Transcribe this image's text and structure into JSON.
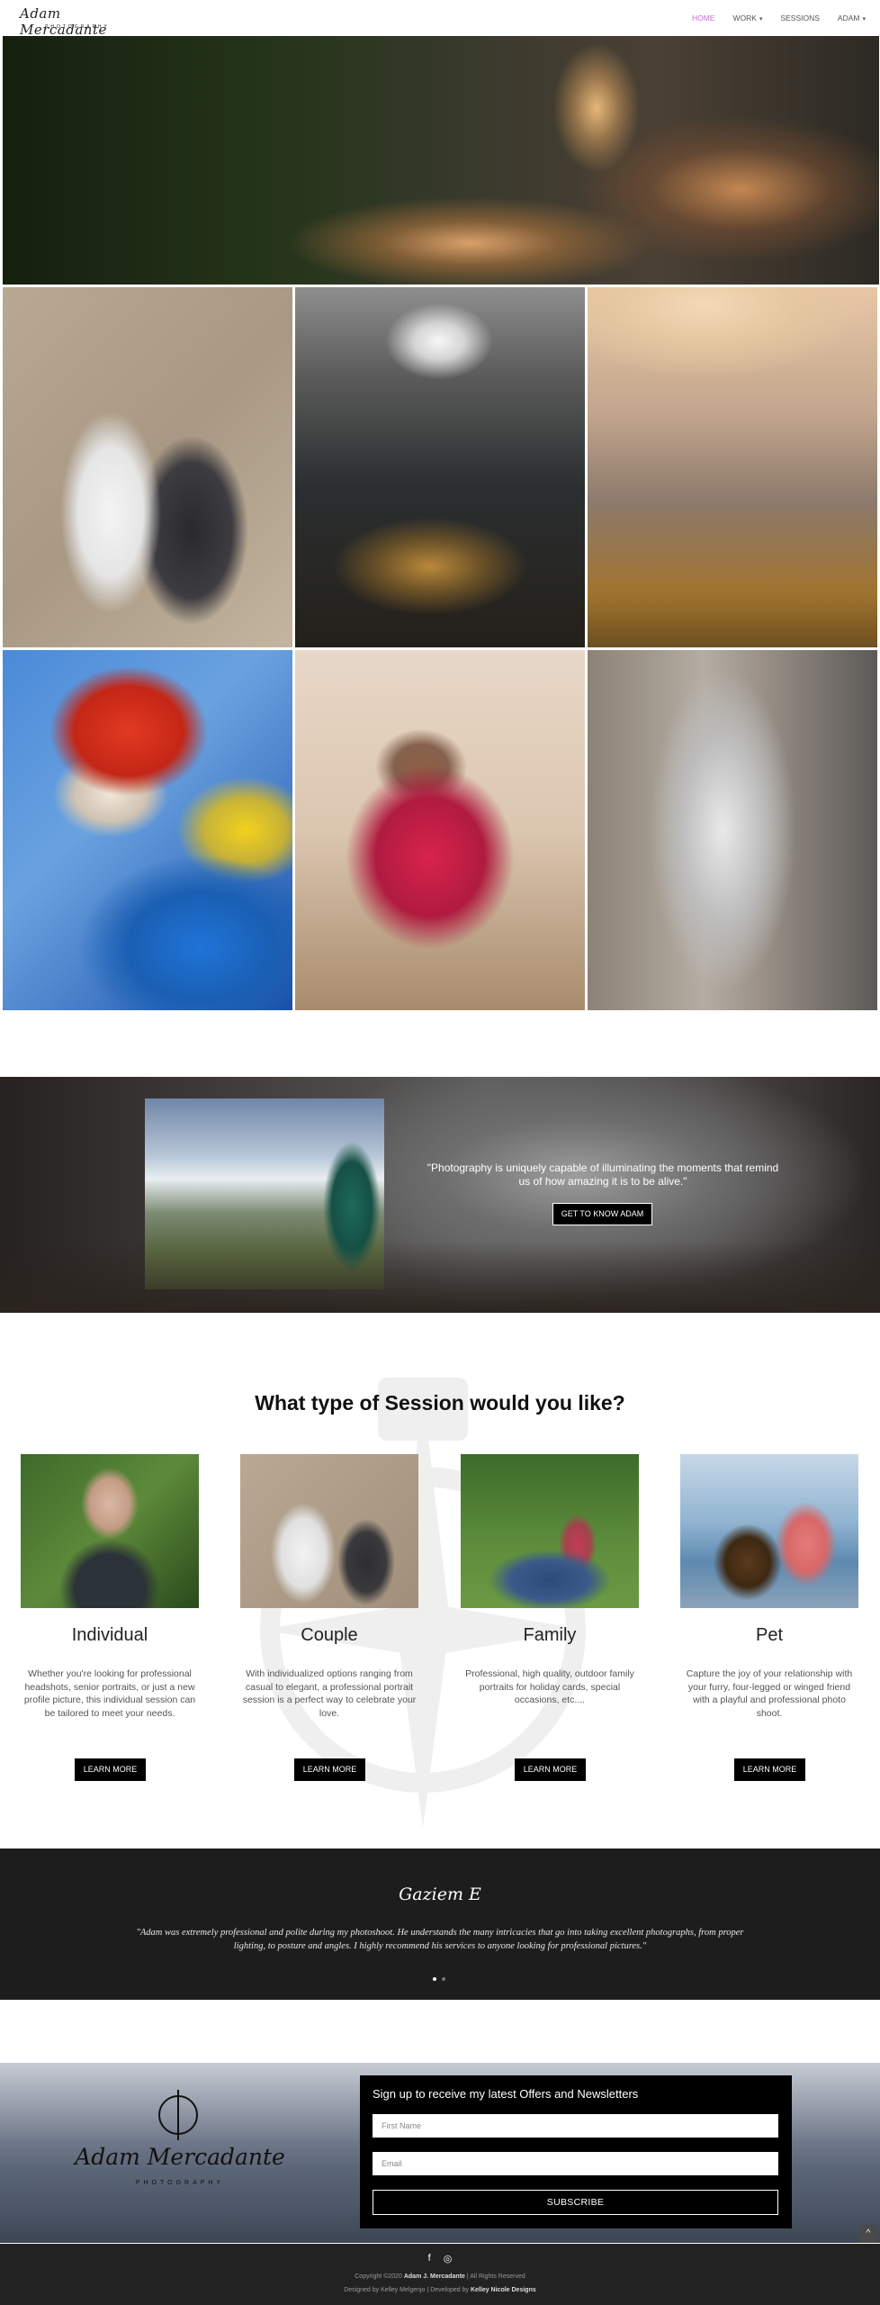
{
  "header": {
    "logo_script": "Adam Mercadante",
    "logo_sub": "PHOTOGRAPHY",
    "nav": [
      {
        "label": "HOME",
        "active": true,
        "has_menu": false
      },
      {
        "label": "WORK",
        "active": false,
        "has_menu": true
      },
      {
        "label": "SESSIONS",
        "active": false,
        "has_menu": false
      },
      {
        "label": "ADAM",
        "active": false,
        "has_menu": true
      }
    ],
    "accent": "#c36fd0"
  },
  "quote_band": {
    "quote": "\"Photography is uniquely capable of illuminating the moments that remind us of how amazing it is to be alive.\"",
    "button": "GET TO KNOW ADAM"
  },
  "sessions": {
    "title": "What type of Session would you like?",
    "cards": [
      {
        "name": "Individual",
        "desc": "Whether you're looking for professional headshots, senior portraits, or just a new profile picture, this individual session can be tailored to meet your needs.",
        "button": "LEARN MORE"
      },
      {
        "name": "Couple",
        "desc": "With individualized options ranging from casual to elegant, a professional portrait session is a perfect way to celebrate your love.",
        "button": "LEARN MORE"
      },
      {
        "name": "Family",
        "desc": "Professional, high quality, outdoor family portraits for holiday cards, special occasions, etc....",
        "button": "LEARN MORE"
      },
      {
        "name": "Pet",
        "desc": "Capture the joy of your relationship with your furry, four-legged or winged friend with a playful and professional photo shoot.",
        "button": "LEARN MORE"
      }
    ]
  },
  "testimonial": {
    "author": "Gaziem E",
    "text": "\"Adam was extremely professional and polite during my photoshoot. He understands the many intricacies that go into taking excellent photographs, from proper lighting, to posture and angles. I highly recommend his services to anyone looking for professional pictures.\""
  },
  "newsletter": {
    "logo_name": "Adam Mercadante",
    "logo_sub": "PHOTOGRAPHY",
    "heading": "Sign up to receive my latest Offers and Newsletters",
    "first_name_placeholder": "First Name",
    "email_placeholder": "Email",
    "submit": "SUBSCRIBE"
  },
  "footer": {
    "facebook_icon": "f",
    "instagram_icon": "◎",
    "copyright_pre": "Copyright ©2020",
    "copyright_name": "Adam J. Mercadante",
    "copyright_post": "| All Rights Reserved",
    "designed_pre": "Designed by Kelley Melgenjo | Developed by",
    "designed_name": "Kelley Nicole Designs"
  },
  "to_top": "^"
}
